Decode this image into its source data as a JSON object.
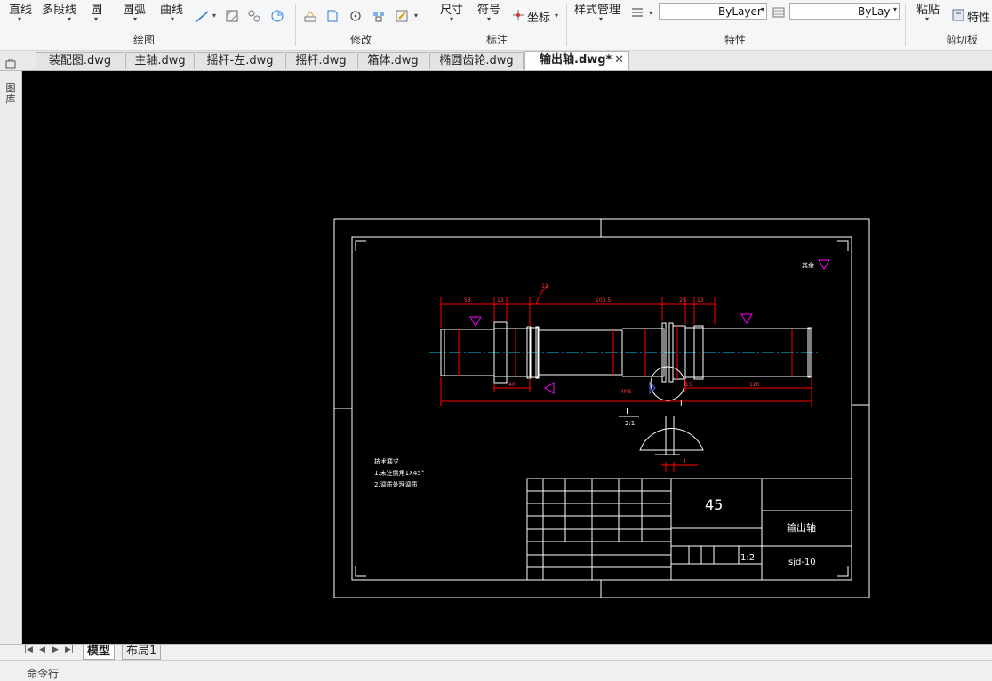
{
  "ribbon": {
    "draw": {
      "line": "直线",
      "polyline": "多段线",
      "circle": "圆",
      "arc": "圆弧",
      "curve": "曲线",
      "group_label": "绘图"
    },
    "modify": {
      "group_label": "修改"
    },
    "annotate": {
      "dimension": "尺寸",
      "symbol": "符号",
      "coordinate": "坐标",
      "group_label": "标注"
    },
    "properties": {
      "style_manager": "样式管理",
      "linetype": "ByLayer",
      "color": "ByLay",
      "group_label": "特性"
    },
    "clipboard": {
      "paste": "粘贴",
      "properties": "特性",
      "group_label": "剪切板"
    }
  },
  "tabs": [
    {
      "label": "装配图.dwg"
    },
    {
      "label": "主轴.dwg"
    },
    {
      "label": "摇杆-左.dwg"
    },
    {
      "label": "摇杆.dwg"
    },
    {
      "label": "箱体.dwg"
    },
    {
      "label": "椭圆齿轮.dwg"
    },
    {
      "label": "输出轴.dwg*",
      "active": true
    }
  ],
  "left_panel": {
    "label": "图库"
  },
  "drawing": {
    "top_dims": [
      "58",
      "13",
      "12",
      "103.5",
      "25",
      "13"
    ],
    "bottom_dims": [
      "40",
      "4M5",
      "15",
      "120"
    ],
    "section_label": "I",
    "detail_label": "I",
    "detail_scale": "2:1",
    "detail_dim": "1",
    "roughness_note": "其余",
    "tech_req": [
      "技术要求",
      "1.未注倒角1X45°",
      "2.调质处理调质"
    ],
    "title_block": {
      "material": "45",
      "part_name": "输出轴",
      "drawing_no": "sjd-10",
      "scale": "1:2"
    }
  },
  "layout_tabs": [
    {
      "label": "模型",
      "active": true
    },
    {
      "label": "布局1"
    }
  ],
  "command_line": "命令行",
  "colors": {
    "canvas_bg": "#000000",
    "frame": "#ffffff",
    "dimension": "#ff0000",
    "centerline": "#00c8ff",
    "roughness": "#ff00ff"
  }
}
